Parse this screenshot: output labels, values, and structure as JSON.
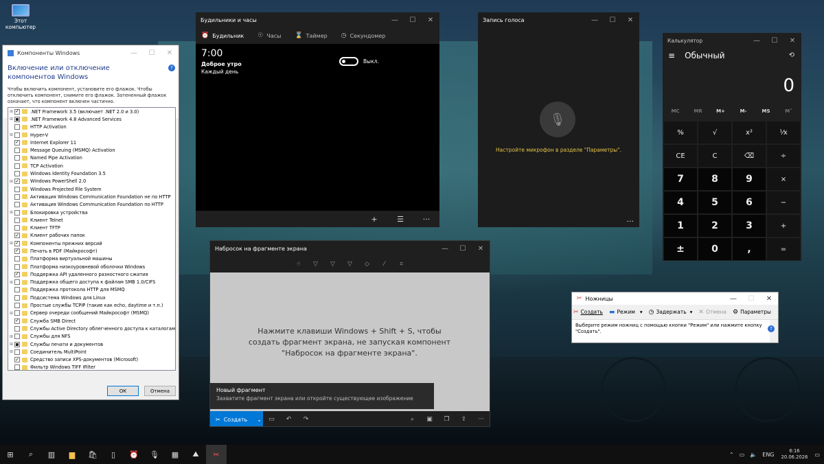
{
  "desktop": {
    "icon_label": "Этот компьютер"
  },
  "components": {
    "title": "Компоненты Windows",
    "heading": "Включение или отключение компонентов Windows",
    "description": "Чтобы включить компонент, установите его флажок. Чтобы отключить компонент, снимите его флажок. Затененный флажок означает, что компонент включен частично.",
    "help": "?",
    "ok": "ОК",
    "cancel": "Отмена",
    "items": [
      {
        "label": ".NET Framework 3.5 (включает .NET 2.0 и 3.0)",
        "expand": true,
        "state": "checked"
      },
      {
        "label": ".NET Framework 4.8 Advanced Services",
        "expand": true,
        "state": "partial"
      },
      {
        "label": "HTTP Activation",
        "expand": false,
        "state": "unchecked"
      },
      {
        "label": "Hyper-V",
        "expand": true,
        "state": "unchecked"
      },
      {
        "label": "Internet Explorer 11",
        "expand": false,
        "state": "checked"
      },
      {
        "label": "Message Queuing (MSMQ) Activation",
        "expand": false,
        "state": "unchecked"
      },
      {
        "label": "Named Pipe Activation",
        "expand": false,
        "state": "unchecked"
      },
      {
        "label": "TCP Activation",
        "expand": false,
        "state": "unchecked"
      },
      {
        "label": "Windows Identity Foundation 3.5",
        "expand": false,
        "state": "unchecked"
      },
      {
        "label": "Windows PowerShell 2.0",
        "expand": true,
        "state": "checked"
      },
      {
        "label": "Windows Projected File System",
        "expand": false,
        "state": "unchecked"
      },
      {
        "label": "Активация Windows Communication Foundation не по HTTP",
        "expand": false,
        "state": "unchecked"
      },
      {
        "label": "Активация Windows Communication Foundation по HTTP",
        "expand": false,
        "state": "unchecked"
      },
      {
        "label": "Блокировка устройства",
        "expand": true,
        "state": "unchecked"
      },
      {
        "label": "Клиент Telnet",
        "expand": false,
        "state": "unchecked"
      },
      {
        "label": "Клиент TFTP",
        "expand": false,
        "state": "unchecked"
      },
      {
        "label": "Клиент рабочих папок",
        "expand": false,
        "state": "checked"
      },
      {
        "label": "Компоненты прежних версий",
        "expand": true,
        "state": "checked"
      },
      {
        "label": "Печать в PDF (Майкрософт)",
        "expand": false,
        "state": "checked"
      },
      {
        "label": "Платформа виртуальной машины",
        "expand": false,
        "state": "unchecked"
      },
      {
        "label": "Платформа низкоуровневой оболочки Windows",
        "expand": false,
        "state": "unchecked"
      },
      {
        "label": "Поддержка API удаленного разностного сжатия",
        "expand": false,
        "state": "checked"
      },
      {
        "label": "Поддержка общего доступа к файлам SMB 1.0/CIFS",
        "expand": true,
        "state": "unchecked"
      },
      {
        "label": "Поддержка протокола HTTP для MSMQ",
        "expand": false,
        "state": "unchecked"
      },
      {
        "label": "Подсистема Windows для Linux",
        "expand": false,
        "state": "unchecked"
      },
      {
        "label": "Простые службы TCPIP (такие как echo, daytime и т.п.)",
        "expand": false,
        "state": "unchecked"
      },
      {
        "label": "Сервер очереди сообщений Майкрософт (MSMQ)",
        "expand": true,
        "state": "unchecked"
      },
      {
        "label": "Служба SMB Direct",
        "expand": false,
        "state": "checked"
      },
      {
        "label": "Службы Active Directory облегченного доступа к каталогам",
        "expand": false,
        "state": "unchecked"
      },
      {
        "label": "Службы для NFS",
        "expand": true,
        "state": "unchecked"
      },
      {
        "label": "Службы печати и документов",
        "expand": true,
        "state": "partial"
      },
      {
        "label": "Соединитель MultiPoint",
        "expand": true,
        "state": "unchecked"
      },
      {
        "label": "Средство записи XPS-документов (Microsoft)",
        "expand": false,
        "state": "checked"
      },
      {
        "label": "Фильтр Windows TIFF IFilter",
        "expand": false,
        "state": "unchecked"
      }
    ]
  },
  "alarms": {
    "title": "Будильники и часы",
    "tabs": [
      "Будильник",
      "Часы",
      "Таймер",
      "Секундомер"
    ],
    "time": "7:00",
    "name": "Доброе утро",
    "repeat": "Каждый день",
    "toggle_label": "Выкл."
  },
  "voice": {
    "title": "Запись голоса",
    "message": "Настройте микрофон в разделе \"Параметры\"."
  },
  "calc": {
    "title": "Калькулятор",
    "mode": "Обычный",
    "display": "0",
    "memory": [
      "MC",
      "MR",
      "M+",
      "M-",
      "MS",
      "M˅"
    ],
    "keys": [
      "%",
      "√",
      "x²",
      "¹⁄x",
      "CE",
      "C",
      "⌫",
      "÷",
      "7",
      "8",
      "9",
      "×",
      "4",
      "5",
      "6",
      "−",
      "1",
      "2",
      "3",
      "+",
      "±",
      "0",
      ",",
      "="
    ]
  },
  "sketch": {
    "title": "Набросок на фрагменте экрана",
    "canvas_text": "Нажмите клавиши Windows + Shift + S, чтобы создать фрагмент экрана, не запуская компонент \"Набросок на фрагменте экрана\".",
    "tip_title": "Новый фрагмент",
    "tip_text": "Захватите фрагмент экрана или откройте существующее изображение",
    "create": "Создать"
  },
  "scissors": {
    "title": "Ножницы",
    "create": "Создать",
    "mode": "Режим",
    "delay": "Задержать",
    "cancel": "Отмена",
    "settings": "Параметры",
    "hint": "Выберите режим ножниц с помощью кнопки \"Режим\" или нажмите кнопку \"Создать\"."
  },
  "taskbar": {
    "lang": "ENG",
    "time": "6:16",
    "date": "20.06.2026"
  }
}
